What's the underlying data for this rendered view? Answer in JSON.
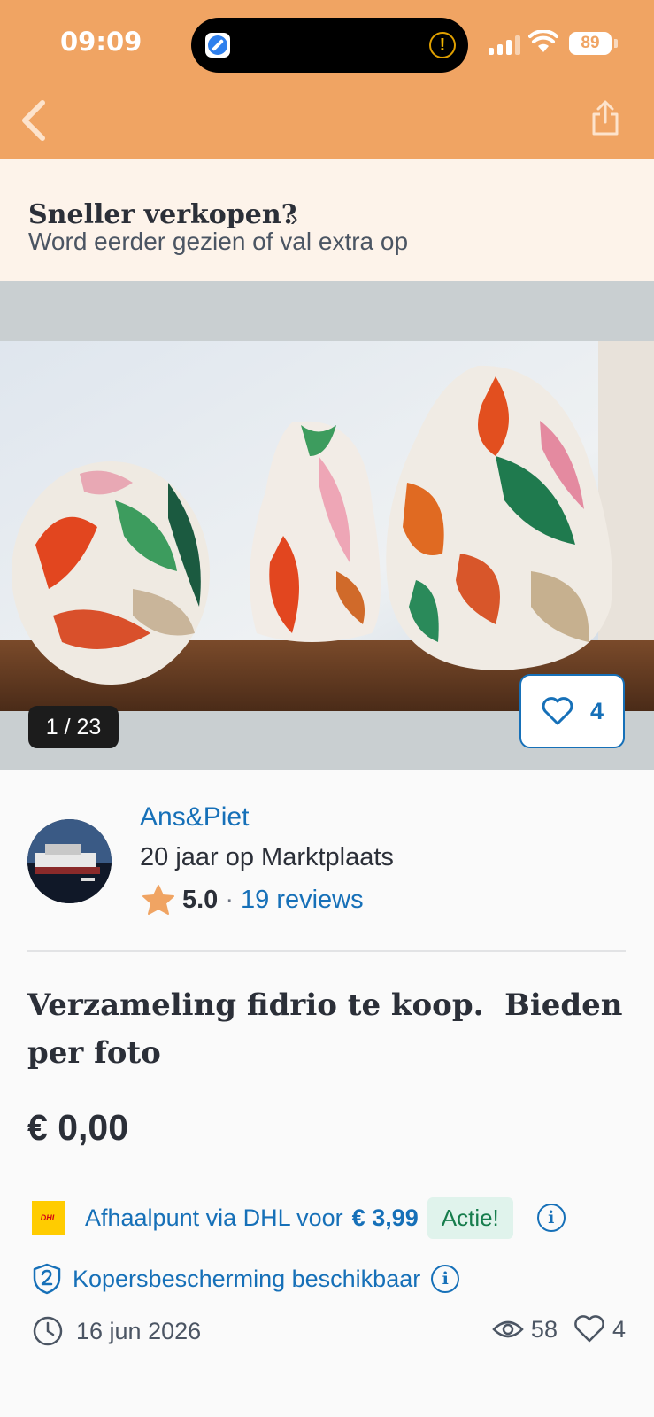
{
  "status_bar": {
    "time": "09:09",
    "battery": "89"
  },
  "promo": {
    "title": "Sneller verkopen?",
    "subtitle": "Word eerder gezien of val extra op"
  },
  "gallery": {
    "counter": "1 / 23",
    "favorites": "4"
  },
  "seller": {
    "name": "Ans&Piet",
    "years": "20 jaar op Marktplaats",
    "rating": "5.0",
    "separator": "·",
    "reviews": "19 reviews"
  },
  "listing": {
    "title": "Verzameling fidrio te koop.  Bieden per foto",
    "price": "€ 0,00"
  },
  "shipping": {
    "logo_text": "DHL",
    "label": "Afhaalpunt via DHL voor",
    "price": "€ 3,99",
    "badge": "Actie!"
  },
  "protection": {
    "label": "Kopersbescherming beschikbaar"
  },
  "meta": {
    "date": "16 jun 2026",
    "views": "58",
    "likes": "4"
  },
  "colors": {
    "header": "#f0a463",
    "link": "#1670b8",
    "badge_bg": "#e0f3ec",
    "badge_text": "#177d4d",
    "star": "#f0a463"
  },
  "icons": {
    "back": "chevron-left-icon",
    "share": "share-icon",
    "favorite": "heart-icon",
    "rating": "star-icon",
    "info": "info-icon",
    "protection": "shield-icon",
    "date": "clock-icon",
    "views": "eye-icon"
  }
}
